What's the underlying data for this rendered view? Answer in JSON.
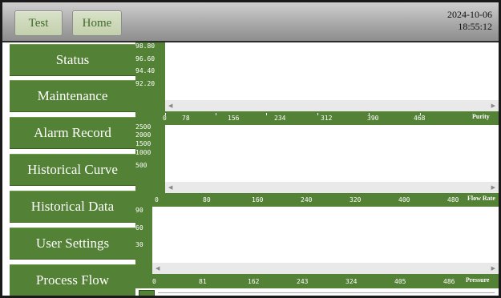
{
  "header": {
    "buttons": [
      {
        "label": "Test"
      },
      {
        "label": "Home"
      }
    ],
    "date": "2024-10-06",
    "time": "18:55:12"
  },
  "nav": [
    {
      "label": "Status"
    },
    {
      "label": "Maintenance"
    },
    {
      "label": "Alarm Record"
    },
    {
      "label": "Historical Curve"
    },
    {
      "label": "Historical Data"
    },
    {
      "label": "User Settings"
    },
    {
      "label": "Process Flow"
    }
  ],
  "chart_data": [
    {
      "type": "line",
      "title": "Purity",
      "y_ticks": [
        "98.80",
        "96.60",
        "94.40",
        "92.20"
      ],
      "x_ticks": [
        "0",
        "78",
        "156",
        "234",
        "312",
        "390",
        "468"
      ],
      "series": []
    },
    {
      "type": "line",
      "title": "Flow Rate",
      "y_ticks": [
        "2500",
        "2000",
        "1500",
        "1000",
        "500"
      ],
      "x_ticks": [
        "0",
        "80",
        "160",
        "240",
        "320",
        "400",
        "480"
      ],
      "series": []
    },
    {
      "type": "line",
      "title": "Pressure",
      "y_ticks": [
        "90",
        "60",
        "30"
      ],
      "x_ticks": [
        "0",
        "81",
        "162",
        "243",
        "324",
        "405",
        "486"
      ],
      "series": []
    }
  ],
  "colors": {
    "nav_green": "#538135",
    "top_gray": "#a9a9a9"
  }
}
